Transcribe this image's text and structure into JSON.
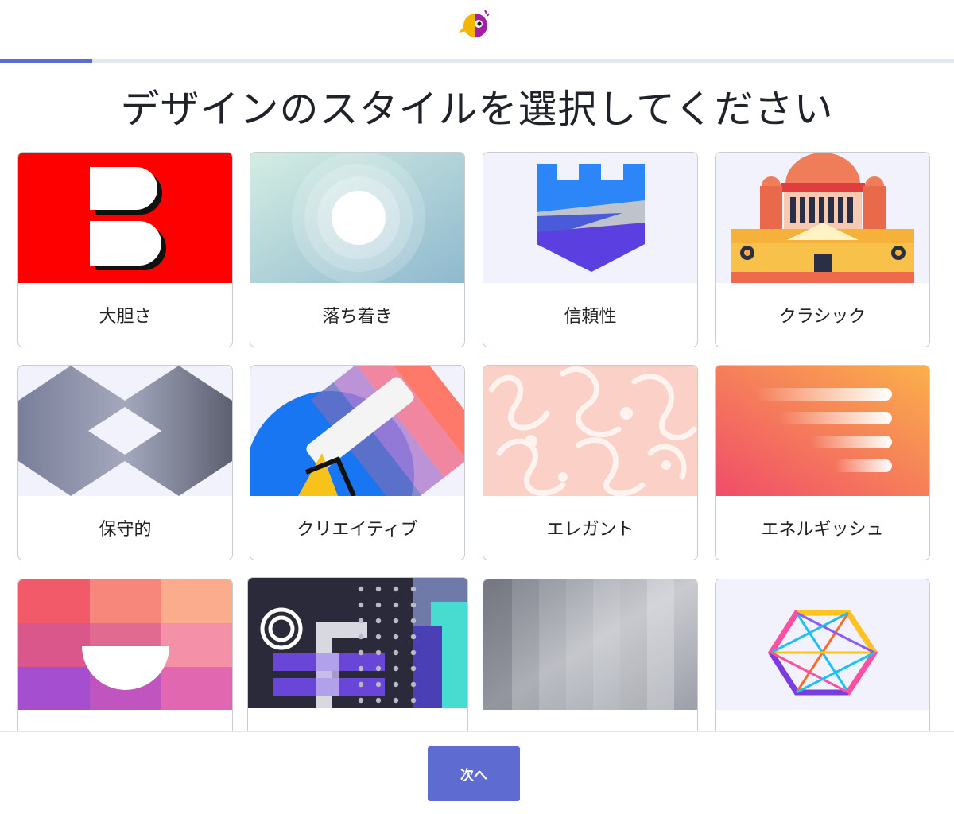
{
  "header": {
    "logo_icon": "parrot-logo-icon",
    "progress_fraction": 0.097
  },
  "page": {
    "title": "デザインのスタイルを選択してください"
  },
  "styles": [
    {
      "label": "大胆さ",
      "icon": "bold-b-icon"
    },
    {
      "label": "落ち着き",
      "icon": "calm-circles-icon"
    },
    {
      "label": "信頼性",
      "icon": "shield-castle-icon"
    },
    {
      "label": "クラシック",
      "icon": "classic-building-icon"
    },
    {
      "label": "保守的",
      "icon": "conservative-pattern-icon"
    },
    {
      "label": "クリエイティブ",
      "icon": "paint-roller-icon"
    },
    {
      "label": "エレガント",
      "icon": "damask-pattern-icon"
    },
    {
      "label": "エネルギッシュ",
      "icon": "speed-lines-icon"
    },
    {
      "label": "",
      "icon": "semicircle-grid-icon"
    },
    {
      "label": "",
      "icon": "geometric-dots-icon"
    },
    {
      "label": "",
      "icon": "metal-texture-icon"
    },
    {
      "label": "",
      "icon": "hexagon-lines-icon"
    }
  ],
  "footer": {
    "next_label": "次へ"
  }
}
